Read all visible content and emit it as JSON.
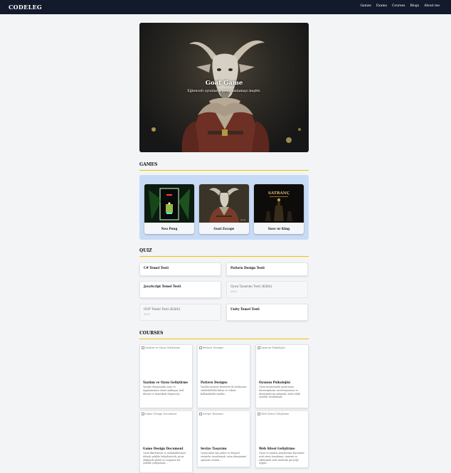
{
  "navbar": {
    "logo": "CODELEG",
    "links": [
      "Games",
      "Exams",
      "Courses",
      "Blogs",
      "About me"
    ]
  },
  "hero": {
    "title": "Goat Game",
    "subtitle": "Eğlenceli oyunlarla programlamayı keşfet."
  },
  "games": {
    "heading": "GAMES",
    "items": [
      {
        "label": "Neo Pong"
      },
      {
        "label": "Goat Escape"
      },
      {
        "label": "Save ur King",
        "thumb_text": "SATRANÇ"
      }
    ]
  },
  "quiz": {
    "heading": "QUIZ",
    "items": [
      {
        "title": "C# Temel Testi",
        "locked": false
      },
      {
        "title": "Pattern Design Testi",
        "locked": false
      },
      {
        "title": "JavaScript Temel Testi",
        "locked": false
      },
      {
        "title": "Oyun Tasarımı Testi (Kilitli)",
        "sub": "Kilitli",
        "locked": true
      },
      {
        "title": "OOP Temel Testi (Kilitli)",
        "sub": "Kilitli",
        "locked": true
      },
      {
        "title": "Unity Temel Testi",
        "locked": false
      }
    ]
  },
  "courses": {
    "heading": "COURSES",
    "items": [
      {
        "alt": "Yazılım ve Oyun Geliştirme",
        "title": "Yazılım ve Oyun Geliştirme",
        "desc": "Yazılım dünyasında oyun ve uygulamalara temel yaklaşım; kod düzeni ve mantıksal düşünceyi..."
      },
      {
        "alt": "Pattern Designs",
        "title": "Pattern Designs",
        "desc": "Yazılım tasarım desenleri ile kodunuzu sürdürülebilir kılma ve tekrar kullanılabilir sınıflar..."
      },
      {
        "alt": "Oyunun Psikolojisi",
        "title": "Oyunun Psikolojisi",
        "desc": "Oyun tasarımında oyuncunun davranışlarını, motivasyonunu ve deneyimlerini anlamak; daha etkili oyunlar tasarlamak..."
      },
      {
        "alt": "Game Design Document",
        "title": "Game Design Document",
        "desc": "Oyun fikirlerinizi ve mekaniklerinizi detaylı şekilde belgeleyerek; proje ekibinizle planlı ve organize bir şekilde çalışmanızı..."
      },
      {
        "alt": "Seviye Tasarımı",
        "title": "Seviye Tasarımı",
        "desc": "Oyunculara ilgi çekici ve dengeli seviyeler tasarlamak; oyun deneyimini optimize etmek..."
      },
      {
        "alt": "Web Sitesi Geliştirme",
        "title": "Web Sitesi Geliştirme",
        "desc": "Oyun ve yazılım projeleriniz kurumsal web sitesi hazırlama; tasarım ve etkileşimli web sitelerini gerçeğe uygun..."
      }
    ]
  },
  "colors": {
    "navbar_bg": "#121a2c",
    "accent_underline": "#f2c200",
    "games_panel_bg": "#c8dbf6"
  }
}
